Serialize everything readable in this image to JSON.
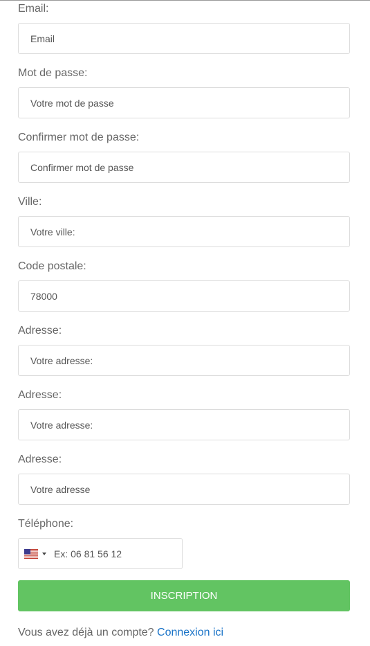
{
  "fields": [
    {
      "label": "Email:",
      "placeholder": "Email",
      "value": ""
    },
    {
      "label": "Mot de passe:",
      "placeholder": "Votre mot de passe",
      "value": ""
    },
    {
      "label": "Confirmer mot de passe:",
      "placeholder": "Confirmer mot de passe",
      "value": ""
    },
    {
      "label": "Ville:",
      "placeholder": "Votre ville:",
      "value": ""
    },
    {
      "label": "Code postale:",
      "placeholder": "",
      "value": "78000"
    },
    {
      "label": "Adresse:",
      "placeholder": "Votre adresse:",
      "value": ""
    },
    {
      "label": "Adresse:",
      "placeholder": "Votre adresse:",
      "value": ""
    },
    {
      "label": "Adresse:",
      "placeholder": "Votre adresse",
      "value": ""
    }
  ],
  "phone": {
    "label": "Téléphone:",
    "country_icon": "us-flag-icon",
    "placeholder": "Ex: 06 81 56 12"
  },
  "submit_label": "INSCRIPTION",
  "login": {
    "prompt": "Vous avez déjà un compte?",
    "link_text": "Connexion ici"
  },
  "colors": {
    "button": "#62c462",
    "link": "#1a73c7"
  }
}
